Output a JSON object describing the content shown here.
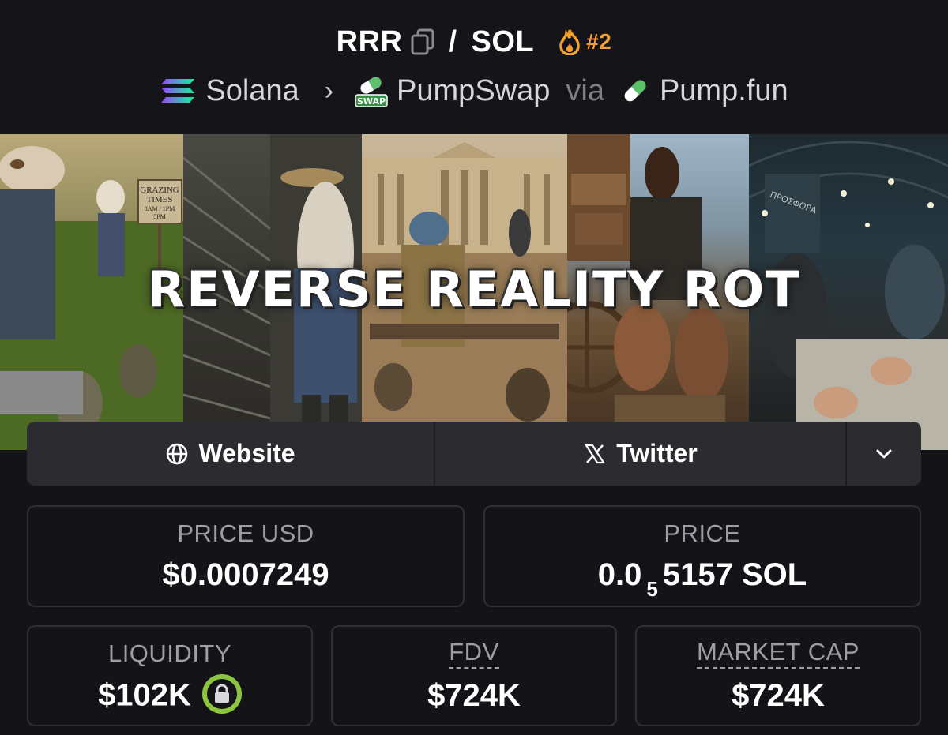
{
  "header": {
    "base_token": "RRR",
    "separator": "/",
    "quote_token": "SOL",
    "rank": "#2"
  },
  "breadcrumb": {
    "chain": "Solana",
    "chevron": "›",
    "dex": "PumpSwap",
    "dex_badge": "SWAP",
    "via": "via",
    "launchpad": "Pump.fun"
  },
  "banner": {
    "title": "REVERSE REALITY ROT",
    "sign_lines": [
      "GRAZING",
      "TIMES",
      "8AM / 1PM",
      "5PM"
    ],
    "store_sign": "ΠΡΟΣΦΟΡΑ"
  },
  "links": {
    "website_label": "Website",
    "twitter_label": "Twitter"
  },
  "stats": {
    "price_usd": {
      "label": "PRICE USD",
      "value": "$0.0007249"
    },
    "price_native": {
      "label": "PRICE",
      "prefix": "0.0",
      "zeros": "5",
      "digits": "5157",
      "unit": "SOL"
    },
    "liquidity": {
      "label": "LIQUIDITY",
      "value": "$102K"
    },
    "fdv": {
      "label": "FDV",
      "value": "$724K"
    },
    "market_cap": {
      "label": "MARKET CAP",
      "value": "$724K"
    }
  },
  "colors": {
    "background": "#141418",
    "card_border": "#2f2f35",
    "rank_orange": "#f3a12c",
    "lock_green": "#8cc63f",
    "label_gray": "#9d9da6"
  },
  "icons": {
    "copy": "copy-icon",
    "flame": "flame-icon",
    "solana": "solana-logo-icon",
    "pumpswap": "pumpswap-logo-icon",
    "pumpfun": "pumpfun-pill-icon",
    "globe": "globe-icon",
    "x": "x-logo-icon",
    "chevron_down": "chevron-down-icon",
    "lock": "lock-icon"
  }
}
